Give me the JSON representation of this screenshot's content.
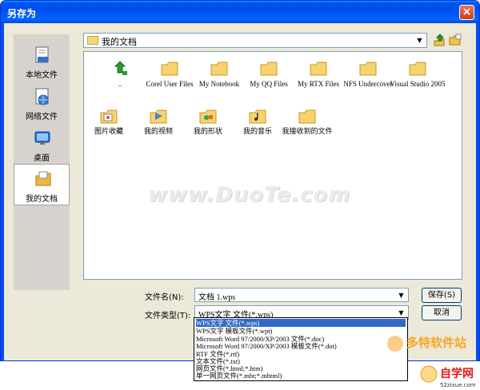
{
  "window": {
    "title": "另存为",
    "close_label": "×"
  },
  "places": [
    {
      "label": "本地文件",
      "icon": "local-file-icon"
    },
    {
      "label": "网络文件",
      "icon": "network-file-icon"
    },
    {
      "label": "桌面",
      "icon": "desktop-icon"
    },
    {
      "label": "我的文档",
      "icon": "my-documents-icon",
      "active": true
    }
  ],
  "save_in": {
    "value": "我的文档"
  },
  "files_row1": [
    {
      "name": "..",
      "icon": "up-folder-icon"
    },
    {
      "name": "Corel User Files",
      "icon": "folder-icon"
    },
    {
      "name": "My Notebook",
      "icon": "folder-icon"
    },
    {
      "name": "My QQ Files",
      "icon": "folder-icon"
    },
    {
      "name": "My RTX Files",
      "icon": "folder-icon"
    },
    {
      "name": "NFS Undercover",
      "icon": "folder-icon"
    },
    {
      "name": "Visual Studio 2005",
      "icon": "folder-icon"
    }
  ],
  "files_row2": [
    {
      "name": "图片收藏",
      "icon": "pictures-folder-icon"
    },
    {
      "name": "我的视频",
      "icon": "video-folder-icon"
    },
    {
      "name": "我的形状",
      "icon": "shapes-folder-icon"
    },
    {
      "name": "我的音乐",
      "icon": "music-folder-icon"
    },
    {
      "name": "我接收到的文件",
      "icon": "received-folder-icon"
    }
  ],
  "watermark": "www.DuoTe.com",
  "form": {
    "filename_label": "文件名(N):",
    "filename_value": "文档 1.wps",
    "filetype_label": "文件类型(T):",
    "filetype_value": "WPS文字 文件(*.wps)",
    "save_label": "保存(S)",
    "cancel_label": "取消"
  },
  "filetype_options": [
    "WPS文字 文件(*.wps)",
    "WPS文字 模板文件(*.wpt)",
    "Microsoft Word 97/2000/XP/2003 文件(*.doc)",
    "Microsoft Word 97/2000/XP/2003 模板文件(*.dot)",
    "RTF 文件(*.rtf)",
    "文本文件(*.txt)",
    "网页文件(*.html;*.htm)",
    "单一网页文件(*.mht;*.mhtml)"
  ],
  "logos": {
    "duote": "多特软件站",
    "zixue": "自学网",
    "zixue_url": "52zixue.com"
  },
  "colors": {
    "title_bar": "#0050ee",
    "selection": "#316ac5",
    "folder": "#f5d67a"
  }
}
